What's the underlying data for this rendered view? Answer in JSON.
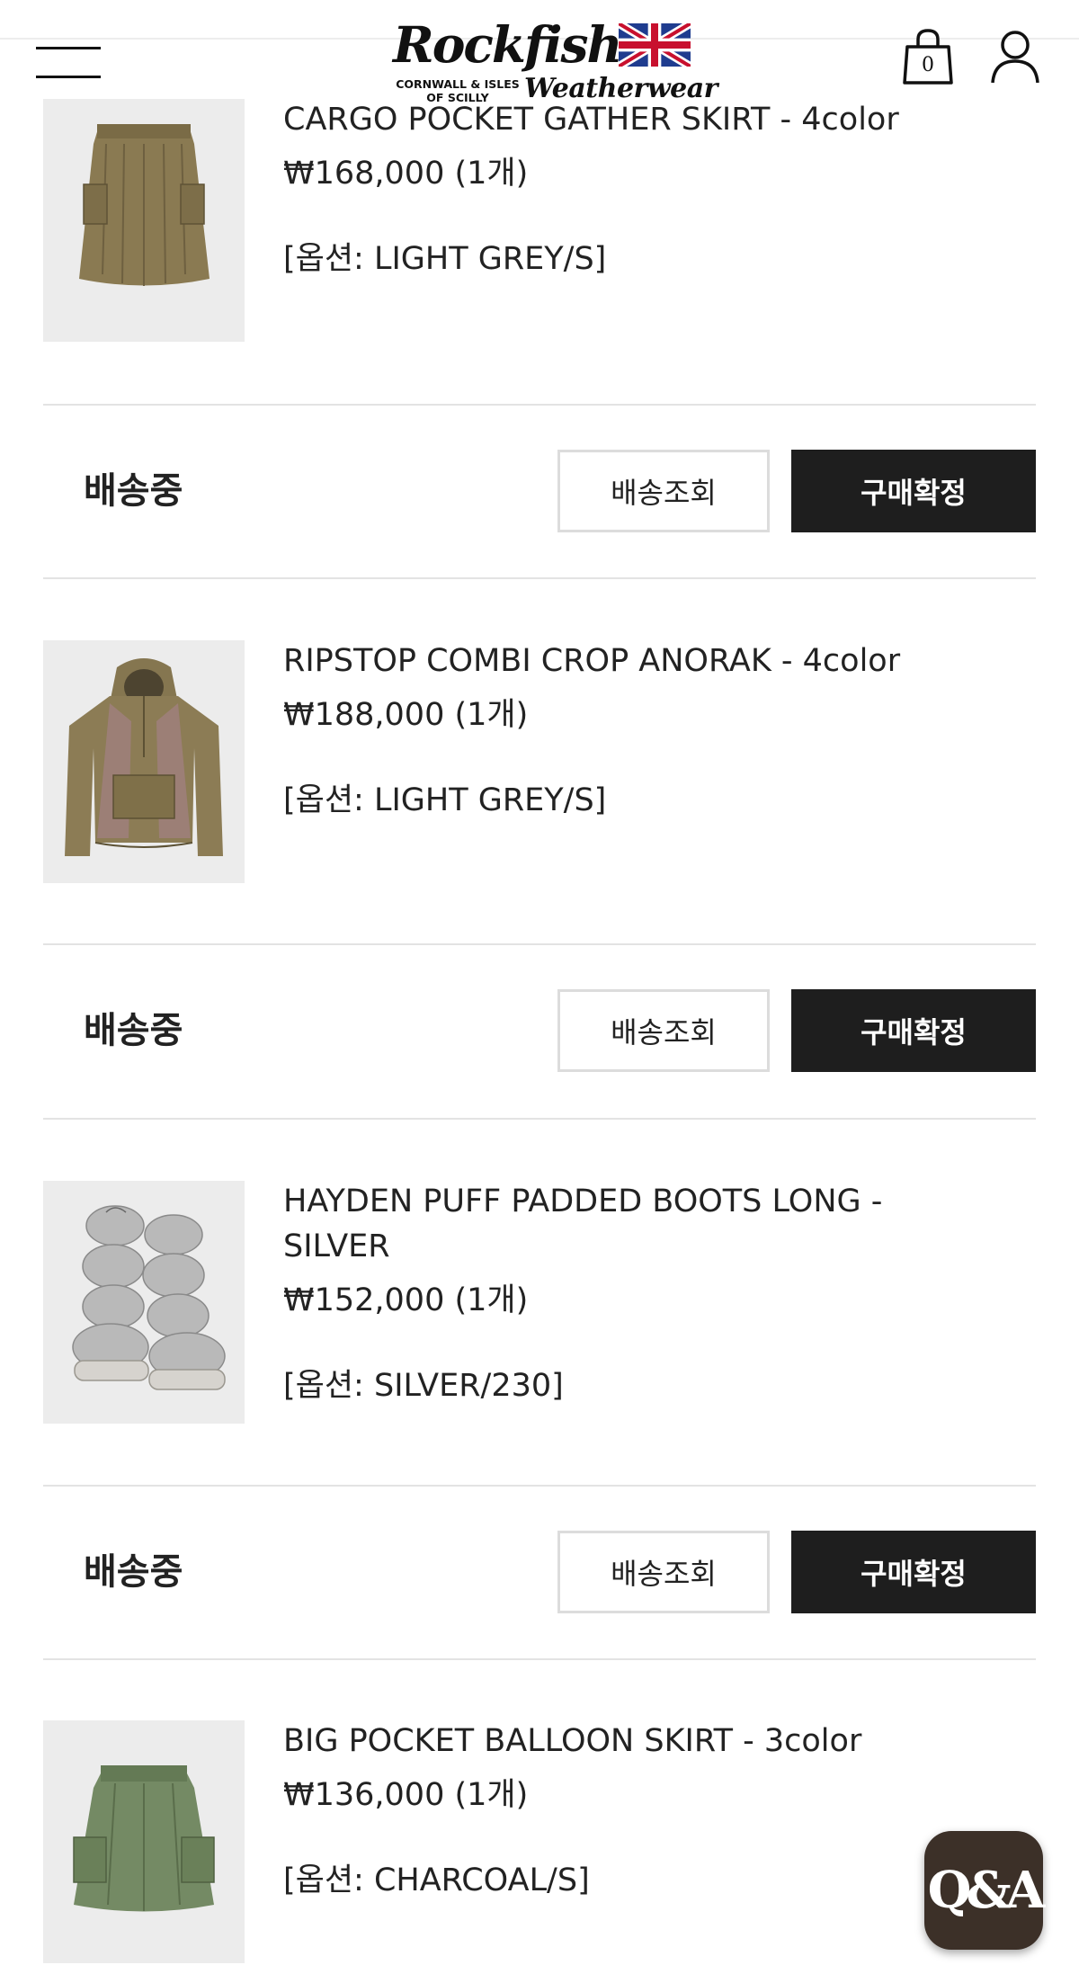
{
  "header": {
    "brand_name": "Rockfish",
    "brand_sub": "CORNWALL & ISLES OF SCILLY",
    "brand_tag": "Weatherwear",
    "cart_count": "0"
  },
  "orders": [
    {
      "name": "CARGO POCKET GATHER SKIRT - 4color",
      "price": "₩168,000 (1개)",
      "option": "[옵션: LIGHT GREY/S]",
      "status": "배송중",
      "track_label": "배송조회",
      "confirm_label": "구매확정"
    },
    {
      "name": "RIPSTOP COMBI CROP ANORAK - 4color",
      "price": "₩188,000 (1개)",
      "option": "[옵션: LIGHT GREY/S]",
      "status": "배송중",
      "track_label": "배송조회",
      "confirm_label": "구매확정"
    },
    {
      "name": "HAYDEN PUFF PADDED BOOTS LONG - SILVER",
      "price": "₩152,000 (1개)",
      "option": "[옵션: SILVER/230]",
      "status": "배송중",
      "track_label": "배송조회",
      "confirm_label": "구매확정"
    },
    {
      "name": "BIG POCKET BALLOON SKIRT - 3color",
      "price": "₩136,000 (1개)",
      "option": "[옵션: CHARCOAL/S]"
    }
  ],
  "qa_button": {
    "label": "Q&A"
  },
  "colors": {
    "button_dark": "#1e1e1e",
    "qa_bg": "#3c3028",
    "thumb_bg": "#ececec",
    "divider": "#e3e3e3"
  }
}
